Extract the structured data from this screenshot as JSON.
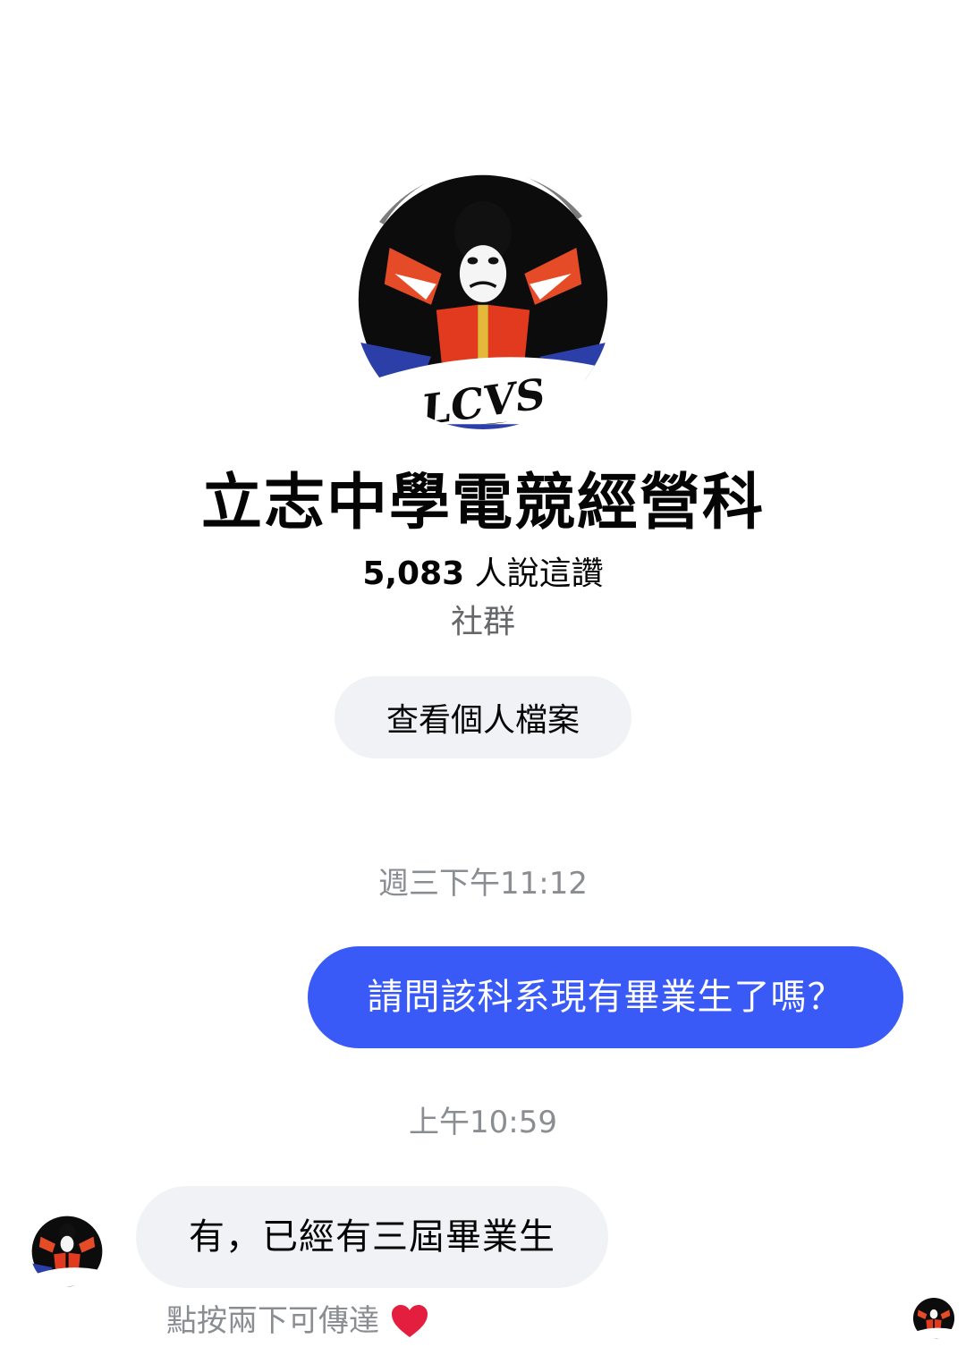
{
  "profile": {
    "name": "立志中學電競經營科",
    "likes_count": "5,083",
    "likes_suffix": " 人說這讚",
    "category": "社群",
    "view_profile_label": "查看個人檔案",
    "logo_text": "LCVS"
  },
  "conversation": {
    "messages": [
      {
        "timestamp": "週三下午11:12",
        "direction": "outgoing",
        "text": "請問該科系現有畢業生了嗎？"
      },
      {
        "timestamp": "上午10:59",
        "direction": "incoming",
        "text": "有，已經有三屆畢業生"
      }
    ],
    "hint": "點按兩下可傳達",
    "hint_icon": "heart-icon"
  },
  "colors": {
    "outgoing_bubble": "#3a5af8",
    "incoming_bubble": "#f0f2f5",
    "heart": "#e41e3f"
  }
}
